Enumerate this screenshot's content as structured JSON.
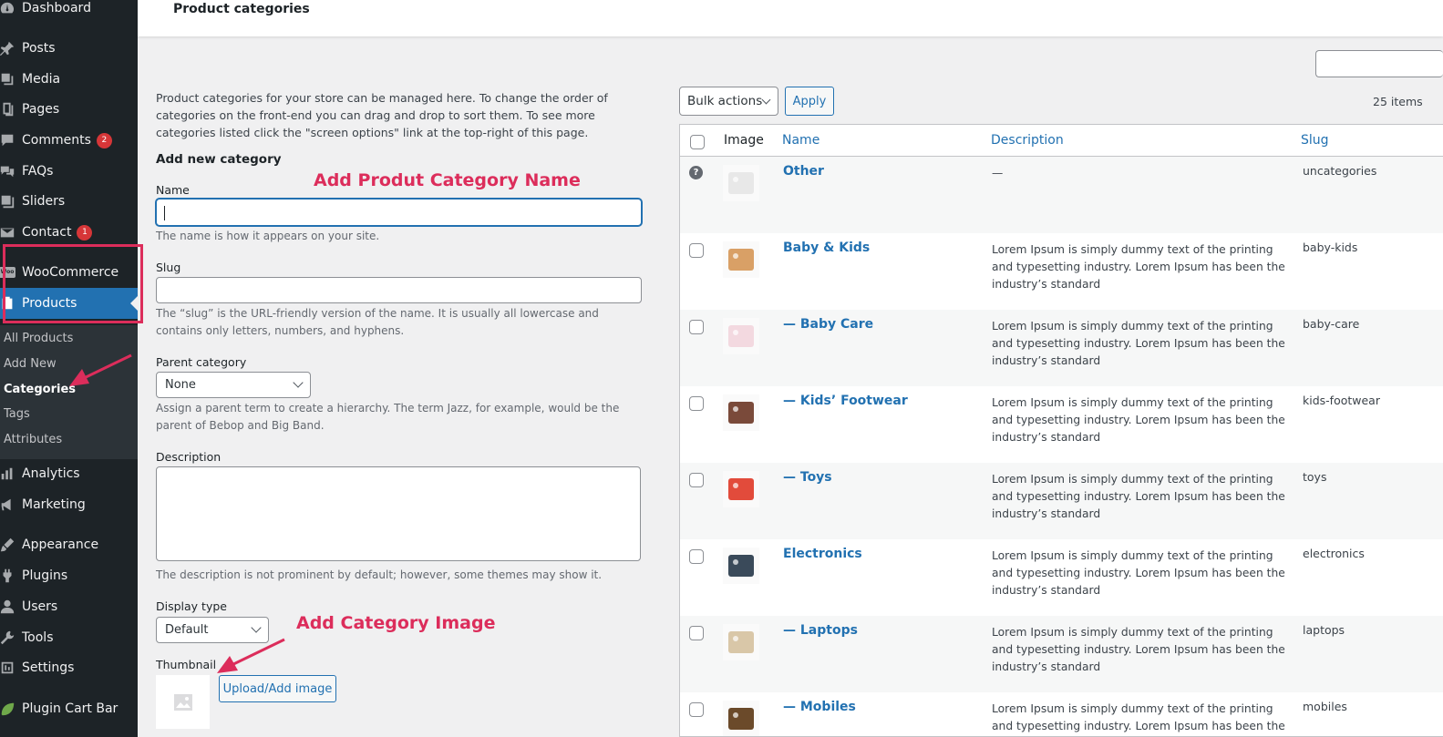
{
  "sidebar": {
    "items": [
      {
        "label": "Dashboard",
        "icon": "dashboard-icon"
      },
      {
        "label": "Posts",
        "icon": "pin-icon"
      },
      {
        "label": "Media",
        "icon": "media-icon"
      },
      {
        "label": "Pages",
        "icon": "pages-icon"
      },
      {
        "label": "Comments",
        "icon": "comments-icon",
        "badge": "2"
      },
      {
        "label": "FAQs",
        "icon": "faq-icon"
      },
      {
        "label": "Sliders",
        "icon": "sliders-icon"
      },
      {
        "label": "Contact",
        "icon": "mail-icon",
        "badge": "1"
      },
      {
        "label": "WooCommerce",
        "icon": "woocommerce-icon"
      },
      {
        "label": "Products",
        "icon": "products-icon"
      },
      {
        "label": "Analytics",
        "icon": "analytics-icon"
      },
      {
        "label": "Marketing",
        "icon": "megaphone-icon"
      },
      {
        "label": "Appearance",
        "icon": "brush-icon"
      },
      {
        "label": "Plugins",
        "icon": "plugin-icon"
      },
      {
        "label": "Users",
        "icon": "user-icon"
      },
      {
        "label": "Tools",
        "icon": "wrench-icon"
      },
      {
        "label": "Settings",
        "icon": "settings-icon"
      },
      {
        "label": "Plugin Cart Bar",
        "icon": "leaf-icon"
      }
    ],
    "woo_logo_text": "Woo",
    "submenu": [
      "All Products",
      "Add New",
      "Categories",
      "Tags",
      "Attributes"
    ]
  },
  "header": {
    "title": "Product categories"
  },
  "form": {
    "intro": "Product categories for your store can be managed here. To change the order of categories on the front-end you can drag and drop to sort them. To see more categories listed click the \"screen options\" link at the top-right of this page.",
    "heading": "Add new category",
    "name_label": "Name",
    "name_help": "The name is how it appears on your site.",
    "slug_label": "Slug",
    "slug_help": "The “slug” is the URL-friendly version of the name. It is usually all lowercase and contains only letters, numbers, and hyphens.",
    "parent_label": "Parent category",
    "parent_value": "None",
    "parent_help": "Assign a parent term to create a hierarchy. The term Jazz, for example, would be the parent of Bebop and Big Band.",
    "desc_label": "Description",
    "desc_help": "The description is not prominent by default; however, some themes may show it.",
    "display_label": "Display type",
    "display_value": "Default",
    "thumb_label": "Thumbnail",
    "upload_button": "Upload/Add image"
  },
  "annotations": {
    "name_note": "Add Produt Category Name",
    "image_note": "Add Category Image",
    "color": "#dc2d5b"
  },
  "table": {
    "bulk_label": "Bulk actions",
    "apply_label": "Apply",
    "items_count": "25 items",
    "columns": [
      "Image",
      "Name",
      "Description",
      "Slug"
    ],
    "rows": [
      {
        "name": "Other",
        "description": "—",
        "slug": "uncategories",
        "thumb_color": "#e8e8e8",
        "default": true
      },
      {
        "name": "Baby & Kids",
        "description": "Lorem Ipsum is simply dummy text of the printing and typesetting industry. Lorem Ipsum has been the industry’s standard",
        "slug": "baby-kids",
        "thumb_color": "#d9a066"
      },
      {
        "name": "— Baby Care",
        "description": "Lorem Ipsum is simply dummy text of the printing and typesetting industry. Lorem Ipsum has been the industry’s standard",
        "slug": "baby-care",
        "thumb_color": "#f3d9e0"
      },
      {
        "name": "— Kids’ Footwear",
        "description": "Lorem Ipsum is simply dummy text of the printing and typesetting industry. Lorem Ipsum has been the industry’s standard",
        "slug": "kids-footwear",
        "thumb_color": "#7a4a3a"
      },
      {
        "name": "— Toys",
        "description": "Lorem Ipsum is simply dummy text of the printing and typesetting industry. Lorem Ipsum has been the industry’s standard",
        "slug": "toys",
        "thumb_color": "#e24b3b"
      },
      {
        "name": "Electronics",
        "description": "Lorem Ipsum is simply dummy text of the printing and typesetting industry. Lorem Ipsum has been the industry’s standard",
        "slug": "electronics",
        "thumb_color": "#3a4a5a"
      },
      {
        "name": "— Laptops",
        "description": "Lorem Ipsum is simply dummy text of the printing and typesetting industry. Lorem Ipsum has been the industry’s standard",
        "slug": "laptops",
        "thumb_color": "#d9c7a8"
      },
      {
        "name": "— Mobiles",
        "description": "Lorem Ipsum is simply dummy text of the printing and typesetting industry. Lorem Ipsum has been the industry’s standard",
        "slug": "mobiles",
        "thumb_color": "#6b4a2a"
      }
    ]
  }
}
